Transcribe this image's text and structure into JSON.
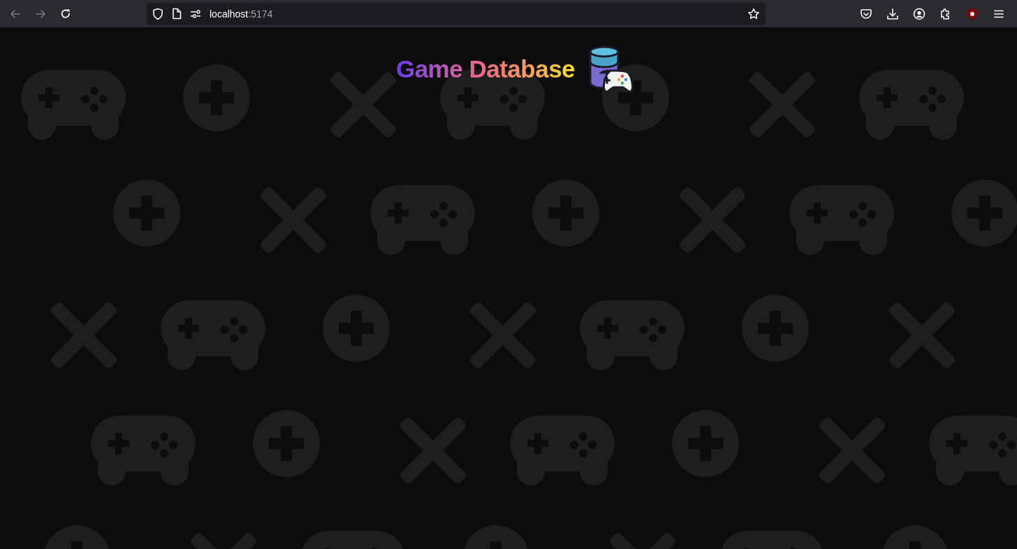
{
  "browser": {
    "back": {
      "disabled": true
    },
    "forward": {
      "disabled": true
    },
    "url_host": "localhost",
    "url_port": ":5174"
  },
  "page": {
    "title": "Game Database"
  }
}
